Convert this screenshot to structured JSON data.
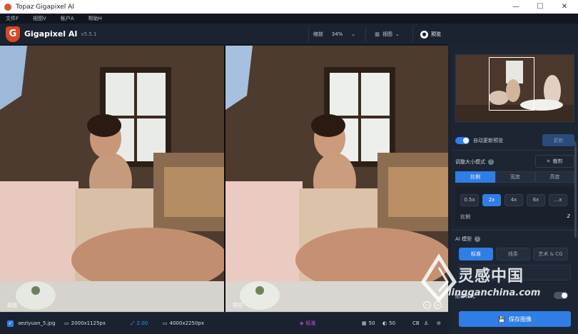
{
  "window": {
    "title": "Topaz Gigapixel AI",
    "minimize": "—",
    "maximize": "☐",
    "close": "✕"
  },
  "menu": [
    {
      "label": "文件F"
    },
    {
      "label": "视图V"
    },
    {
      "label": "帐户A"
    },
    {
      "label": "帮助H"
    }
  ],
  "header": {
    "logo": "G",
    "brand": "Gigapixel AI",
    "version": "v5.5.1",
    "zoom_label": "缩放",
    "zoom_value": "34%",
    "view_label": "视图",
    "preview_label": "预览"
  },
  "viewport": {
    "left_label": "原图",
    "right_label": "预览"
  },
  "status": {
    "filename": "aeziyuan_5.jpg",
    "src_size": "2000x1125px",
    "scale": "2.00",
    "out_size": "4000x2250px",
    "mode": "标准",
    "val1": "50",
    "val2": "50",
    "cb": "CB"
  },
  "sidebar": {
    "auto_update_label": "自动更新预览",
    "update_button": "更新",
    "resize_mode_label": "调整大小模式",
    "crop_label": "裁剪",
    "resize_tabs": [
      "比例",
      "宽度",
      "高度"
    ],
    "scales": [
      "0.5x",
      "2x",
      "4x",
      "6x",
      "...x"
    ],
    "ratio_label": "比例",
    "ratio_value": "2",
    "ai_model_label": "AI 模型",
    "models": [
      "标准",
      "线条",
      "艺术 & CG"
    ],
    "face_label": "脸部优化",
    "save_button": "保存图像"
  },
  "watermark": {
    "title": "灵感中国",
    "subtitle": "lingganchina.com"
  },
  "colors": {
    "accent": "#2f7ee6",
    "background": "#1b2230",
    "logo": "#d64a23"
  }
}
